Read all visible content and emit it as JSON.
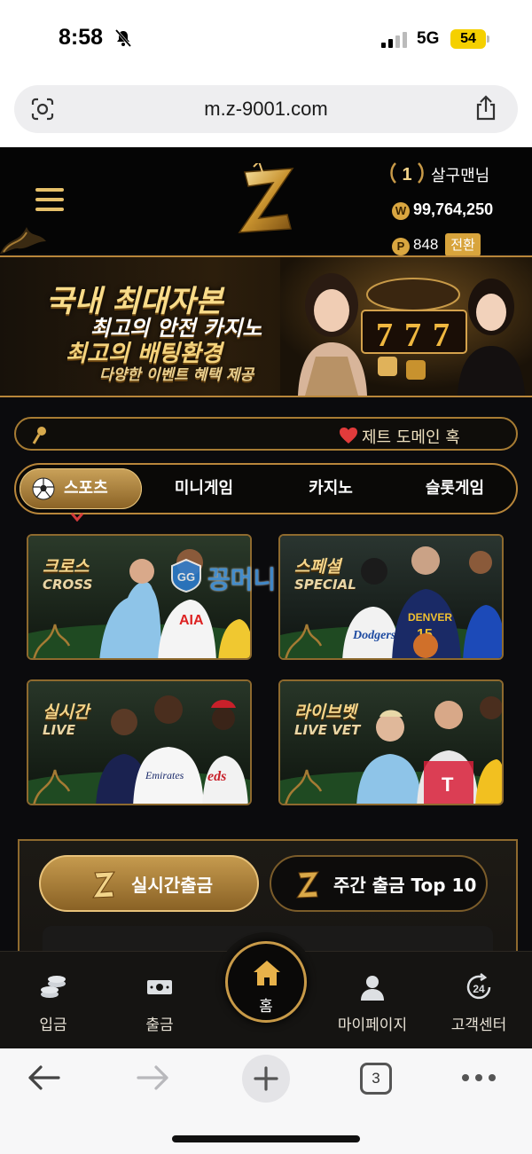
{
  "status": {
    "time": "8:58",
    "network": "5G",
    "battery": "54"
  },
  "browser": {
    "url": "m.z-9001.com",
    "tab_count": "3"
  },
  "header": {
    "level": "1",
    "username": "살구맨님",
    "balance": "99,764,250",
    "points": "848",
    "convert_label": "전환",
    "coin_w": "W",
    "coin_p": "P"
  },
  "banner": {
    "line1": "국내 최대자본",
    "line2": "최고의 안전 카지노",
    "line3": "최고의 배팅환경",
    "line4": "다양한 이벤트 혜택 제공"
  },
  "notice": {
    "text": "제트 도메인 혹"
  },
  "category_tabs": [
    {
      "label": "스포츠",
      "active": true
    },
    {
      "label": "미니게임",
      "active": false
    },
    {
      "label": "카지노",
      "active": false
    },
    {
      "label": "슬롯게임",
      "active": false
    }
  ],
  "games": [
    {
      "title": "크로스",
      "subtitle": "CROSS"
    },
    {
      "title": "스페셜",
      "subtitle": "SPECIAL"
    },
    {
      "title": "실시간",
      "subtitle": "LIVE"
    },
    {
      "title": "라이브벳",
      "subtitle": "LIVE VET"
    }
  ],
  "watermark": "꽁머니",
  "payout": {
    "live_label": "실시간출금",
    "weekly_label": "주간 출금 Top 10"
  },
  "bottom_nav": [
    {
      "label": "입금",
      "icon": "coins-icon"
    },
    {
      "label": "출금",
      "icon": "cash-icon"
    },
    {
      "label": "홈",
      "icon": "home-icon"
    },
    {
      "label": "마이페이지",
      "icon": "user-icon"
    },
    {
      "label": "고객센터",
      "icon": "support-24-icon"
    }
  ],
  "colors": {
    "gold": "#c89a48",
    "background": "#0b0b0d",
    "accent_text": "#f5d58a"
  }
}
